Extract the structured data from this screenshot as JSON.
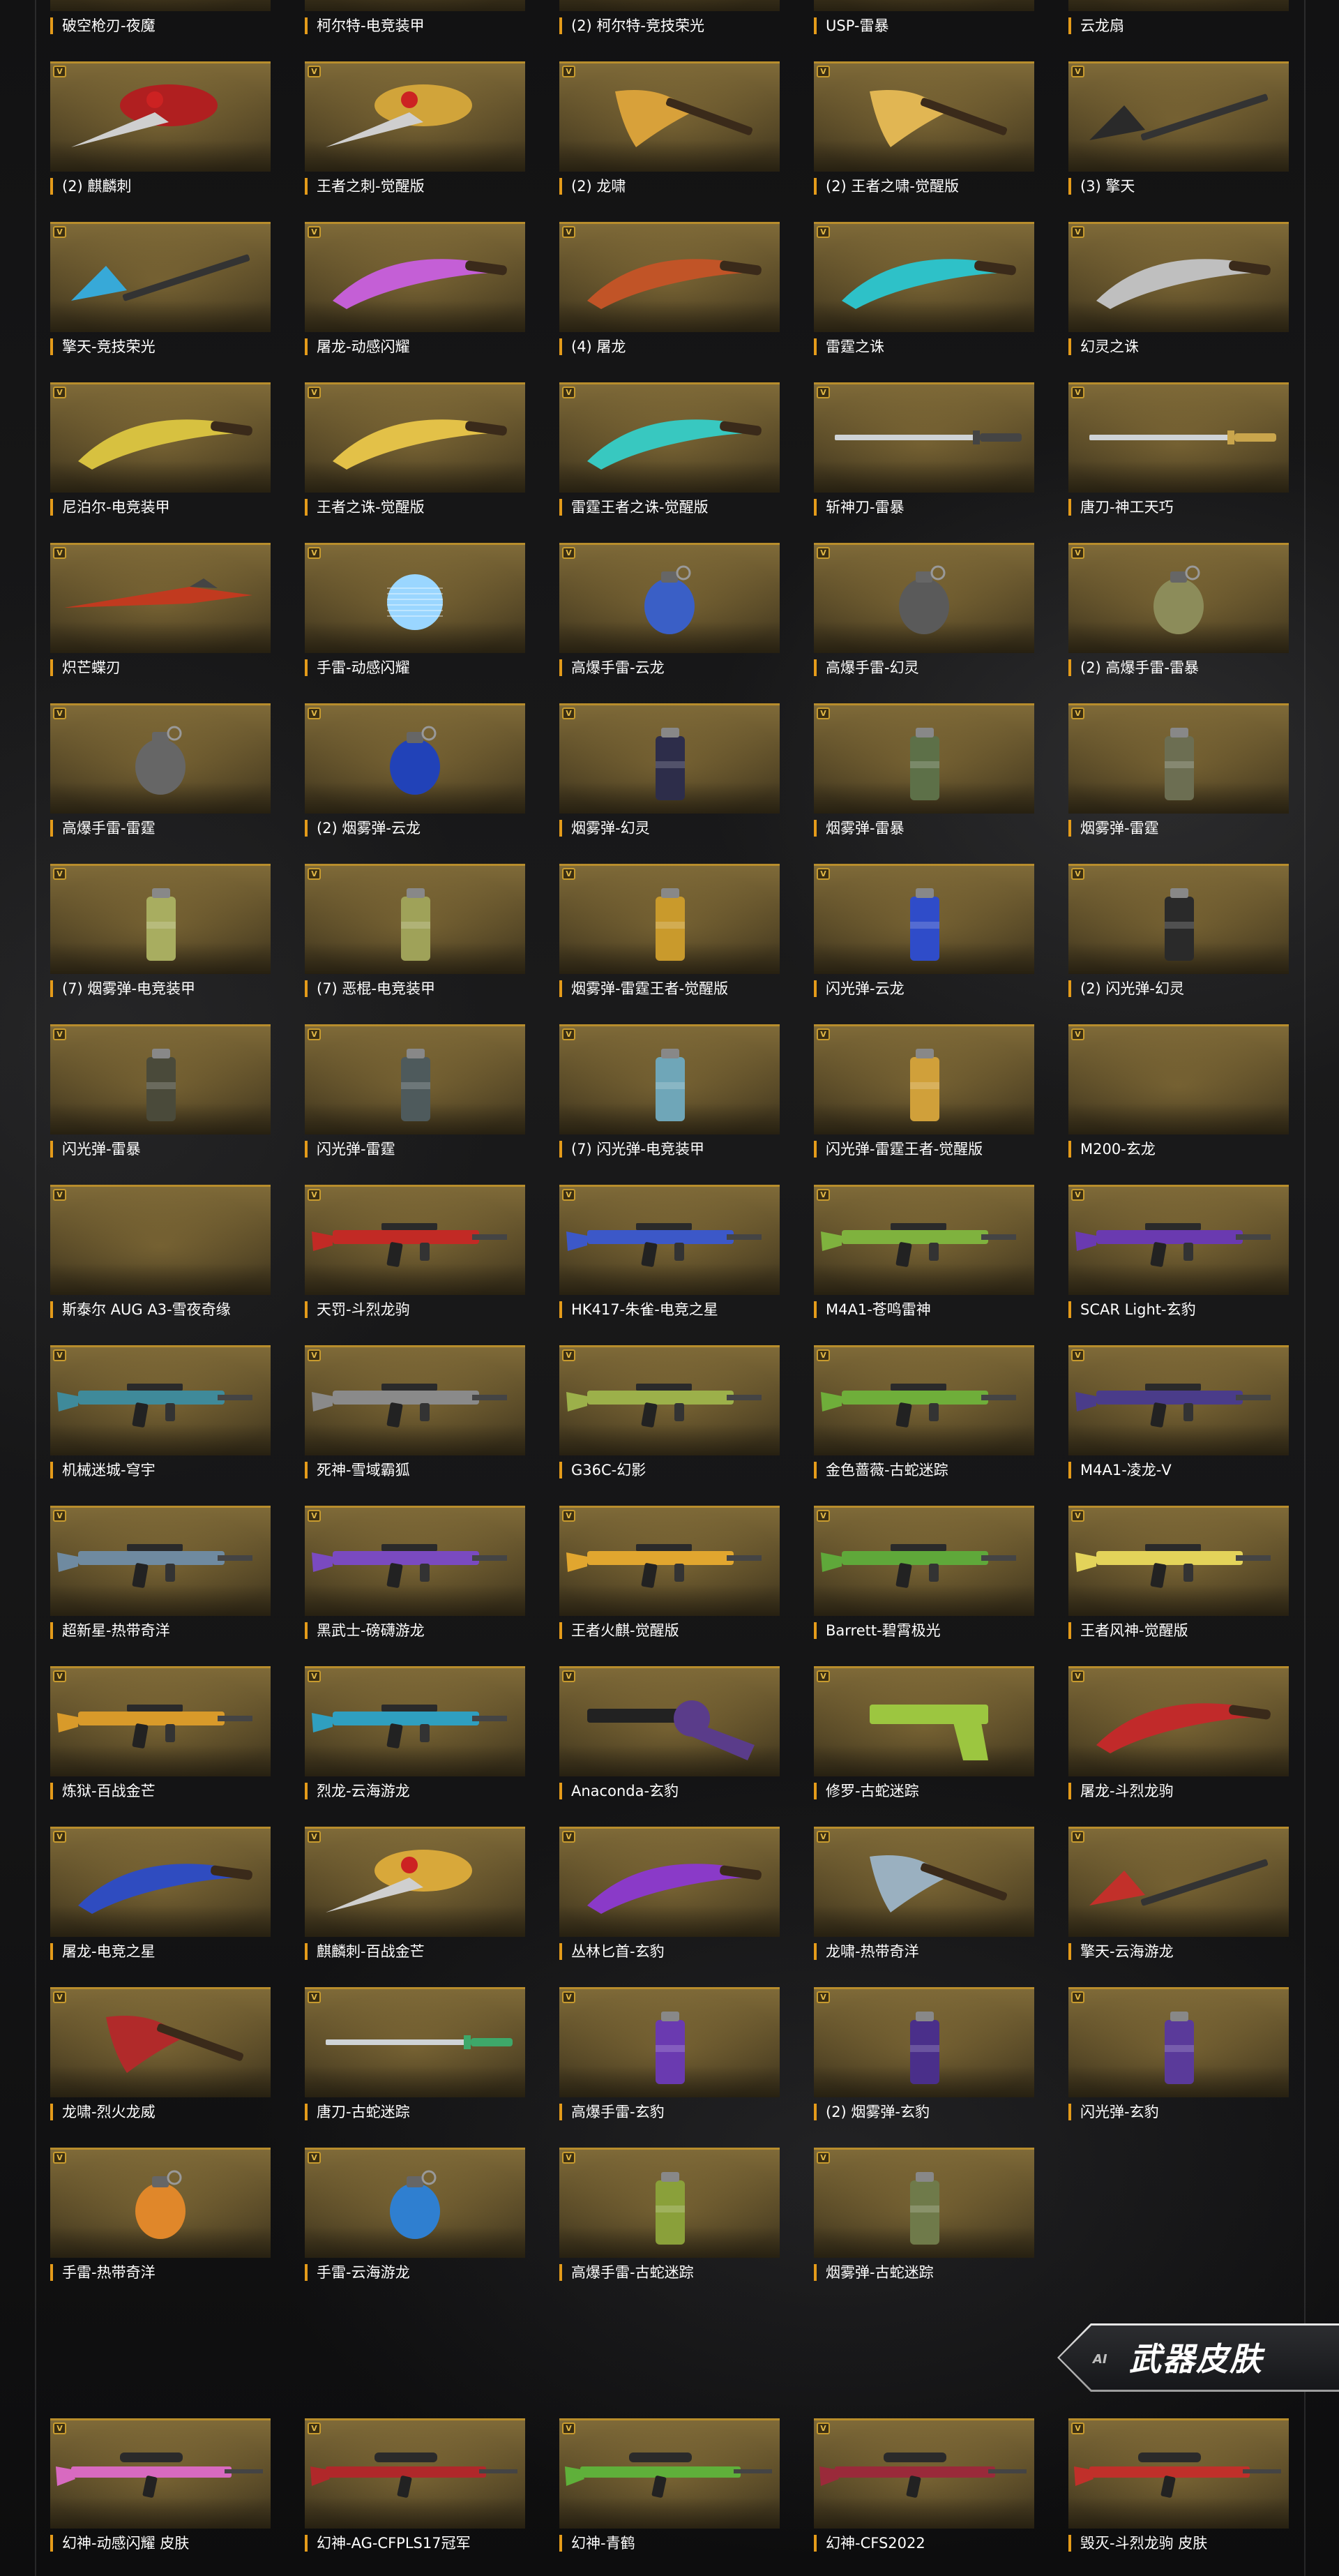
{
  "section": {
    "banner_title": "武器皮肤",
    "banner_mark": "AI"
  },
  "badge_glyph": "V",
  "colors": {
    "tile_border": "#b88d2c",
    "label_accent": "#e49b1a",
    "tile_gold": "#7f6a38"
  },
  "items": [
    {
      "label": "破空枪刃-夜魔",
      "art": "blade",
      "color": "#333333"
    },
    {
      "label": "柯尔特-电竞装甲",
      "art": "none",
      "color": "#333333"
    },
    {
      "label": "(2) 柯尔特-竞技荣光",
      "art": "none",
      "color": "#333333"
    },
    {
      "label": "USP-雷暴",
      "art": "none",
      "color": "#333333"
    },
    {
      "label": "云龙扇",
      "art": "none",
      "color": "#333333"
    },
    {
      "label": "(2) 麒麟刺",
      "art": "ornate",
      "color": "#b01f20"
    },
    {
      "label": "王者之刺-觉醒版",
      "art": "ornate",
      "color": "#d1a43a"
    },
    {
      "label": "(2) 龙啸",
      "art": "axe",
      "color": "#d8a13a"
    },
    {
      "label": "(2) 王者之啸-觉醒版",
      "art": "axe",
      "color": "#e1b653"
    },
    {
      "label": "(3) 擎天",
      "art": "spear",
      "color": "#2a2a2a"
    },
    {
      "label": "擎天-竞技荣光",
      "art": "spear",
      "color": "#37a9d8"
    },
    {
      "label": "屠龙-动感闪耀",
      "art": "kukri",
      "color": "#c45fd6"
    },
    {
      "label": "(4) 屠龙",
      "art": "kukri",
      "color": "#c15427"
    },
    {
      "label": "雷霆之诛",
      "art": "kukri",
      "color": "#2ec1c8"
    },
    {
      "label": "幻灵之诛",
      "art": "kukri",
      "color": "#bfbfbf"
    },
    {
      "label": "尼泊尔-电竞装甲",
      "art": "kukri",
      "color": "#d7c140"
    },
    {
      "label": "王者之诛-觉醒版",
      "art": "kukri",
      "color": "#e3c148"
    },
    {
      "label": "雷霆王者之诛-觉醒版",
      "art": "kukri",
      "color": "#38c8c0"
    },
    {
      "label": "斩神刀-雷暴",
      "art": "sword",
      "color": "#444444"
    },
    {
      "label": "唐刀-神工天巧",
      "art": "sword",
      "color": "#c9a54c"
    },
    {
      "label": "炽芒蝶刃",
      "art": "blade",
      "color": "#c13a1f"
    },
    {
      "label": "手雷-动感闪耀",
      "art": "disco",
      "color": "#9ad6ff"
    },
    {
      "label": "高爆手雷-云龙",
      "art": "grenade",
      "color": "#3a5fc6"
    },
    {
      "label": "高爆手雷-幻灵",
      "art": "grenade",
      "color": "#5a5a5a"
    },
    {
      "label": "(2) 高爆手雷-雷暴",
      "art": "grenade",
      "color": "#8c8c5a"
    },
    {
      "label": "高爆手雷-雷霆",
      "art": "grenade",
      "color": "#666666"
    },
    {
      "label": "(2) 烟雾弹-云龙",
      "art": "grenade",
      "color": "#2142b8"
    },
    {
      "label": "烟雾弹-幻灵",
      "art": "canister",
      "color": "#2d2d4a"
    },
    {
      "label": "烟雾弹-雷暴",
      "art": "canister",
      "color": "#5d7048"
    },
    {
      "label": "烟雾弹-雷霆",
      "art": "canister",
      "color": "#6c6e52"
    },
    {
      "label": "(7) 烟雾弹-电竞装甲",
      "art": "canister",
      "color": "#a8ad60"
    },
    {
      "label": "(7) 恶棍-电竞装甲",
      "art": "canister",
      "color": "#9fa259"
    },
    {
      "label": "烟雾弹-雷霆王者-觉醒版",
      "art": "canister",
      "color": "#c99a2c"
    },
    {
      "label": "闪光弹-云龙",
      "art": "canister",
      "color": "#2f4cc9"
    },
    {
      "label": "(2) 闪光弹-幻灵",
      "art": "canister",
      "color": "#2a2a2a"
    },
    {
      "label": "闪光弹-雷暴",
      "art": "canister",
      "color": "#4a4a3a"
    },
    {
      "label": "闪光弹-雷霆",
      "art": "canister",
      "color": "#4e5a5c"
    },
    {
      "label": "(7) 闪光弹-电竞装甲",
      "art": "canister",
      "color": "#6fa6b8"
    },
    {
      "label": "闪光弹-雷霆王者-觉醒版",
      "art": "canister",
      "color": "#d0a03a"
    },
    {
      "label": "M200-玄龙",
      "art": "none",
      "color": "#333333"
    },
    {
      "label": "斯泰尔 AUG A3-雪夜奇缘",
      "art": "none",
      "color": "#333333"
    },
    {
      "label": "天罚-斗烈龙驹",
      "art": "rifle",
      "color": "#c22a25"
    },
    {
      "label": "HK417-朱雀-电竞之星",
      "art": "rifle",
      "color": "#3c58c8"
    },
    {
      "label": "M4A1-苍鸣雷神",
      "art": "rifle",
      "color": "#7fb23e"
    },
    {
      "label": "SCAR Light-玄豹",
      "art": "rifle",
      "color": "#6a3ab0"
    },
    {
      "label": "机械迷城-穹宇",
      "art": "rifle",
      "color": "#3f8a9a"
    },
    {
      "label": "死神-雪域霸狐",
      "art": "rifle",
      "color": "#8a8a8a"
    },
    {
      "label": "G36C-幻影",
      "art": "rifle",
      "color": "#9cb04a"
    },
    {
      "label": "金色蔷薇-古蛇迷踪",
      "art": "rifle",
      "color": "#6fae3a"
    },
    {
      "label": "M4A1-凌龙-V",
      "art": "rifle",
      "color": "#4a3c8a"
    },
    {
      "label": "超新星-热带奇洋",
      "art": "rifle",
      "color": "#6f8aa0"
    },
    {
      "label": "黑武士-磅礴游龙",
      "art": "rifle",
      "color": "#7a4ac0"
    },
    {
      "label": "王者火麒-觉醒版",
      "art": "rifle",
      "color": "#e1a62f"
    },
    {
      "label": "Barrett-碧霄极光",
      "art": "rifle",
      "color": "#5fa83a"
    },
    {
      "label": "王者风神-觉醒版",
      "art": "rifle",
      "color": "#e3d35a"
    },
    {
      "label": "炼狱-百战金芒",
      "art": "rifle",
      "color": "#d89a2a"
    },
    {
      "label": "烈龙-云海游龙",
      "art": "rifle",
      "color": "#2f9fc0"
    },
    {
      "label": "Anaconda-玄豹",
      "art": "revolver",
      "color": "#5a3c8a"
    },
    {
      "label": "修罗-古蛇迷踪",
      "art": "pistol",
      "color": "#9cc640"
    },
    {
      "label": "屠龙-斗烈龙驹",
      "art": "kukri",
      "color": "#c12a2a"
    },
    {
      "label": "屠龙-电竞之星",
      "art": "kukri",
      "color": "#2f4cc0"
    },
    {
      "label": "麒麟刺-百战金芒",
      "art": "ornate",
      "color": "#d8a83a"
    },
    {
      "label": "丛林匕首-玄豹",
      "art": "kukri",
      "color": "#8a3ac8"
    },
    {
      "label": "龙啸-热带奇洋",
      "art": "axe",
      "color": "#9ab0c0"
    },
    {
      "label": "擎天-云海游龙",
      "art": "spear",
      "color": "#c2302a"
    },
    {
      "label": "龙啸-烈火龙威",
      "art": "axe",
      "color": "#b12a2a"
    },
    {
      "label": "唐刀-古蛇迷踪",
      "art": "sword",
      "color": "#3ea86a"
    },
    {
      "label": "高爆手雷-玄豹",
      "art": "canister",
      "color": "#6a3ab0"
    },
    {
      "label": "(2) 烟雾弹-玄豹",
      "art": "canister",
      "color": "#4a2f8a"
    },
    {
      "label": "闪光弹-玄豹",
      "art": "canister",
      "color": "#5a3a9a"
    },
    {
      "label": "手雷-热带奇洋",
      "art": "grenade",
      "color": "#e0872a"
    },
    {
      "label": "手雷-云海游龙",
      "art": "grenade",
      "color": "#2f7fd0"
    },
    {
      "label": "高爆手雷-古蛇迷踪",
      "art": "canister",
      "color": "#8aa03a"
    },
    {
      "label": "烟雾弹-古蛇迷踪",
      "art": "canister",
      "color": "#6f7a4a"
    }
  ],
  "skins": [
    {
      "label": "幻神-动感闪耀 皮肤",
      "art": "sniper",
      "color": "#d86ac0"
    },
    {
      "label": "幻神-AG-CFPLS17冠军",
      "art": "sniper",
      "color": "#b0282a"
    },
    {
      "label": "幻神-青鹤",
      "art": "sniper",
      "color": "#5fb03a"
    },
    {
      "label": "幻神-CFS2022",
      "art": "sniper",
      "color": "#9a2a3a"
    },
    {
      "label": "毁灭-斗烈龙驹 皮肤",
      "art": "sniper",
      "color": "#c0302a"
    }
  ]
}
